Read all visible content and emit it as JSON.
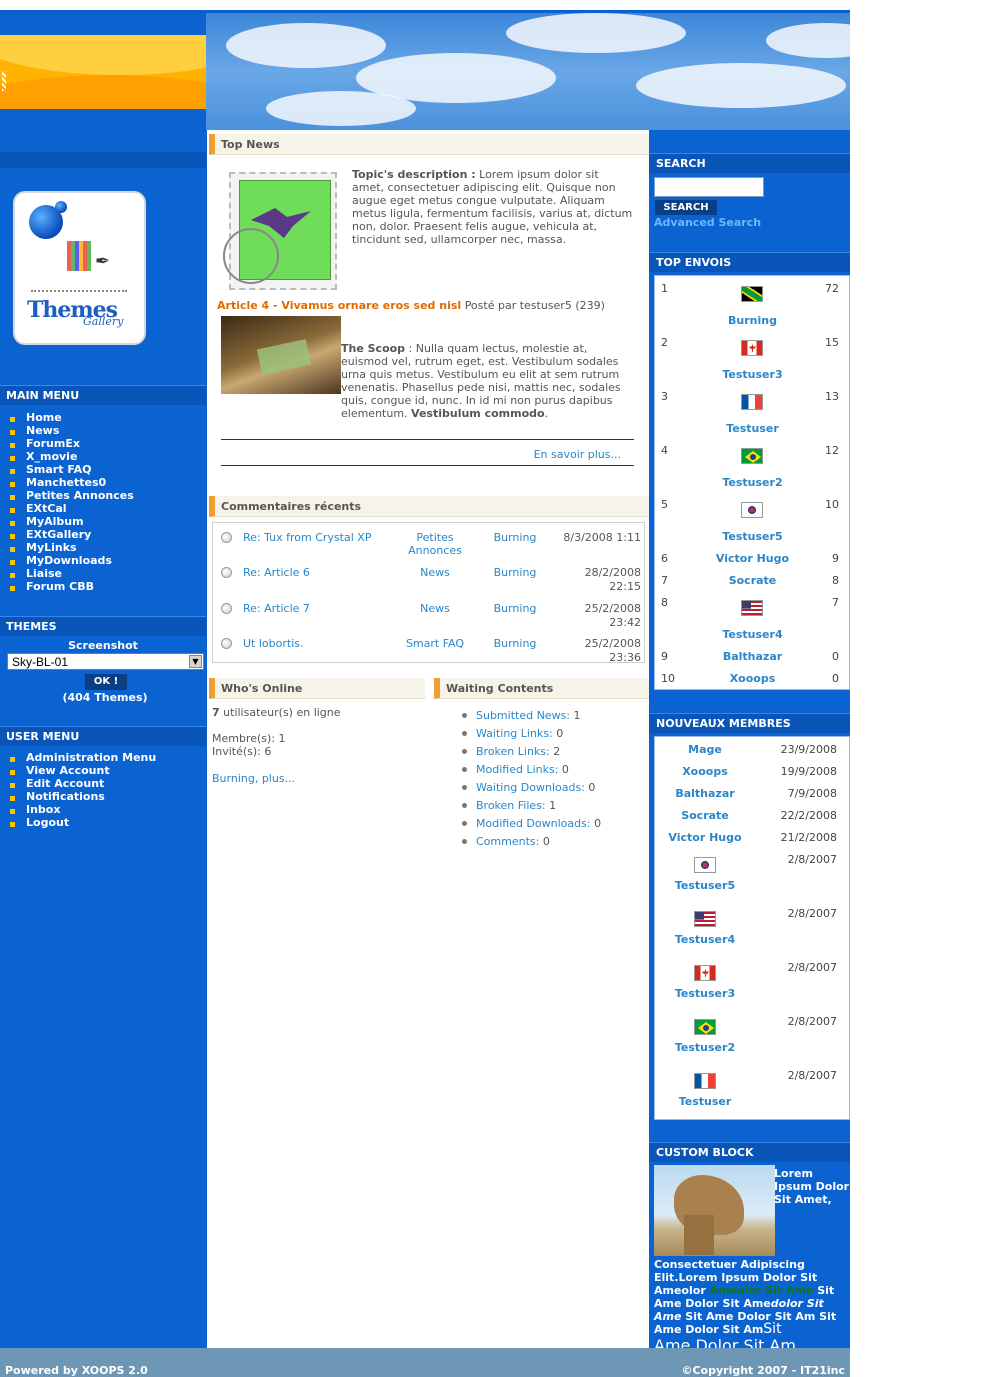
{
  "main_menu": {
    "title": "MAIN MENU",
    "items": [
      "Home",
      "News",
      "ForumEx",
      "X_movie",
      "Smart FAQ",
      "Manchettes0",
      "Petites Annonces",
      "EXtCal",
      "MyAlbum",
      "EXtGallery",
      "MyLinks",
      "MyDownloads",
      "Liaise",
      "Forum CBB"
    ]
  },
  "logo": {
    "text": "Themes",
    "sub": "Gallery"
  },
  "themes": {
    "title": "THEMES",
    "screenshot_label": "Screenshot",
    "selected": "Sky-BL-01",
    "ok_label": "OK !",
    "count": "(404 Themes)"
  },
  "user_menu": {
    "title": "USER MENU",
    "items": [
      "Administration Menu",
      "View Account",
      "Edit Account",
      "Notifications",
      "Inbox",
      "Logout"
    ]
  },
  "top_news": {
    "title": "Top News",
    "topic_label": "Topic's description :",
    "topic_text": "Lorem ipsum dolor sit amet, consectetuer adipiscing elit. Quisque non augue eget metus congue vulputate. Aliquam metus ligula, fermentum facilisis, varius at, dictum non, dolor. Praesent felis augue, vehicula at, tincidunt sed, ullamcorper nec, massa.",
    "article_title": "Article 4 - Vivamus ornare eros sed nisl",
    "article_meta": "Posté par testuser5 (239)",
    "scoop_label": "The Scoop",
    "scoop_text": " : Nulla quam lectus, molestie at, euismod vel, rutrum eget, est. Vestibulum sodales urna quis metus. Vestibulum eu elit at sem rutrum venenatis. Phasellus pede nisi, mattis nec, sodales quis, congue id, nunc. In id mi non purus dapibus elementum. ",
    "scoop_bold_end": "Vestibulum commodo",
    "period": ".",
    "read_more": "En savoir plus..."
  },
  "comments": {
    "title": "Commentaires récents",
    "rows": [
      {
        "title": "Re: Tux from Crystal XP",
        "module": "Petites Annonces",
        "user": "Burning",
        "date": "8/3/2008 1:11"
      },
      {
        "title": "Re: Article 6",
        "module": "News",
        "user": "Burning",
        "date": "28/2/2008 22:15"
      },
      {
        "title": "Re: Article 7",
        "module": "News",
        "user": "Burning",
        "date": "25/2/2008 23:42"
      },
      {
        "title": "Ut lobortis.",
        "module": "Smart FAQ",
        "user": "Burning",
        "date": "25/2/2008 23:36"
      }
    ]
  },
  "whos_online": {
    "title": "Who's Online",
    "count": "7",
    "count_text": " utilisateur(s) en ligne",
    "members": "Membre(s): 1",
    "guests": "Invité(s): 6",
    "link": "Burning, plus..."
  },
  "waiting": {
    "title": "Waiting Contents",
    "items": [
      {
        "label": "Submitted News:",
        "value": "1"
      },
      {
        "label": "Waiting Links:",
        "value": "0"
      },
      {
        "label": "Broken Links:",
        "value": "2"
      },
      {
        "label": "Modified Links:",
        "value": "0"
      },
      {
        "label": "Waiting Downloads:",
        "value": "0"
      },
      {
        "label": "Broken Files:",
        "value": "1"
      },
      {
        "label": "Modified Downloads:",
        "value": "0"
      },
      {
        "label": "Comments:",
        "value": "0"
      }
    ]
  },
  "search": {
    "title": "SEARCH",
    "button": "SEARCH",
    "advanced": "Advanced Search",
    "value": ""
  },
  "top_envois": {
    "title": "TOP ENVOIS",
    "rows": [
      {
        "rank": "1",
        "name": "Burning",
        "count": "72",
        "flag": "jamaica"
      },
      {
        "rank": "2",
        "name": "Testuser3",
        "count": "15",
        "flag": "canada"
      },
      {
        "rank": "3",
        "name": "Testuser",
        "count": "13",
        "flag": "france"
      },
      {
        "rank": "4",
        "name": "Testuser2",
        "count": "12",
        "flag": "brazil"
      },
      {
        "rank": "5",
        "name": "Testuser5",
        "count": "10",
        "flag": "korea"
      },
      {
        "rank": "6",
        "name": "Victor Hugo",
        "count": "9",
        "flag": ""
      },
      {
        "rank": "7",
        "name": "Socrate",
        "count": "8",
        "flag": ""
      },
      {
        "rank": "8",
        "name": "Testuser4",
        "count": "7",
        "flag": "usa"
      },
      {
        "rank": "9",
        "name": "Balthazar",
        "count": "0",
        "flag": ""
      },
      {
        "rank": "10",
        "name": "Xooops",
        "count": "0",
        "flag": ""
      }
    ]
  },
  "new_members": {
    "title": "NOUVEAUX MEMBRES",
    "rows": [
      {
        "name": "Mage",
        "date": "23/9/2008",
        "flag": ""
      },
      {
        "name": "Xooops",
        "date": "19/9/2008",
        "flag": ""
      },
      {
        "name": "Balthazar",
        "date": "7/9/2008",
        "flag": ""
      },
      {
        "name": "Socrate",
        "date": "22/2/2008",
        "flag": ""
      },
      {
        "name": "Victor Hugo",
        "date": "21/2/2008",
        "flag": ""
      },
      {
        "name": "Testuser5",
        "date": "2/8/2007",
        "flag": "korea"
      },
      {
        "name": "Testuser4",
        "date": "2/8/2007",
        "flag": "usa"
      },
      {
        "name": "Testuser3",
        "date": "2/8/2007",
        "flag": "canada"
      },
      {
        "name": "Testuser2",
        "date": "2/8/2007",
        "flag": "brazil"
      },
      {
        "name": "Testuser",
        "date": "2/8/2007",
        "flag": "france"
      }
    ]
  },
  "custom_block": {
    "title": "CUSTOM BLOCK",
    "t1": "Lorem Ipsum Dolor Sit Amet,",
    "t2": "Consectetuer Adipiscing Elit.Lorem Ipsum Dolor Sit Ameolor ",
    "t3": "Ameolor Sit Ame",
    "t4": " Sit Ame Dolor Sit Ame",
    "t5": "dolor Sit Ame",
    "t6": " Sit Ame Dolor Sit Am Sit Ame Dolor Sit Am",
    "t7": "Sit",
    "t8": "Ame Dolor Sit Am"
  },
  "footer": {
    "left": "Powered by XOOPS 2.0",
    "right": "©Copyright 2007 - IT21inc"
  },
  "colors": {
    "blue": "#0b63d1",
    "orange": "#f0a030",
    "link": "#2a86c8",
    "accent_text": "#e06a00"
  }
}
